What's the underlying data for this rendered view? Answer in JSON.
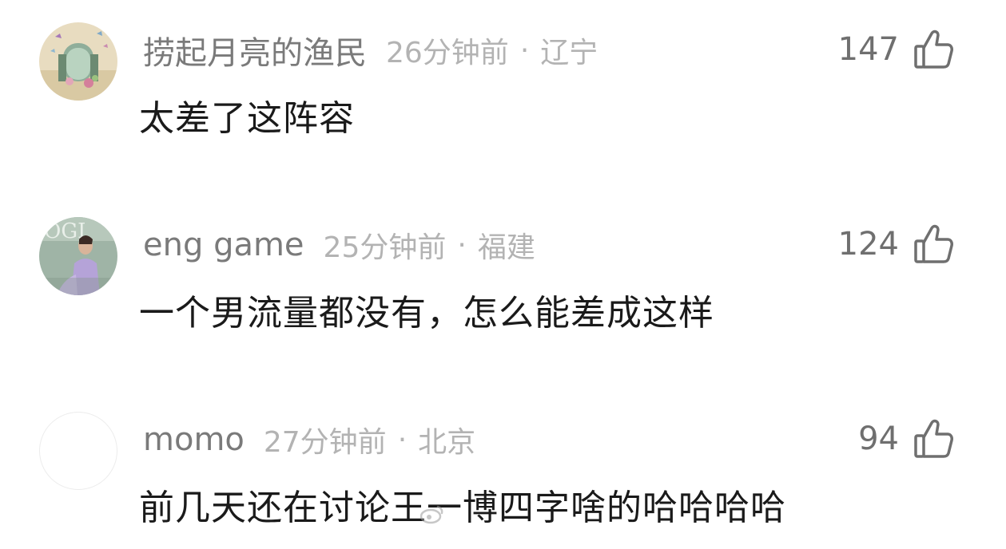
{
  "comments": [
    {
      "username": "捞起月亮的渔民",
      "time": "26分钟前",
      "separator": "·",
      "location": "辽宁",
      "likes": "147",
      "text": "太差了这阵容",
      "avatar": "butterfly-window-avatar"
    },
    {
      "username": "eng game",
      "time": "25分钟前",
      "separator": "·",
      "location": "福建",
      "likes": "124",
      "text": "一个男流量都没有，怎么能差成这样",
      "avatar": "vogue-cover-avatar"
    },
    {
      "username": "momo",
      "time": "27分钟前",
      "separator": "·",
      "location": "北京",
      "likes": "94",
      "text": "前几天还在讨论王一博四字啥的哈哈哈哈",
      "avatar": "blank-avatar"
    }
  ],
  "watermark": {
    "icon": "weibo-icon",
    "text": ""
  },
  "colors": {
    "username": "#7a7a7a",
    "meta": "#b3b3b3",
    "body_text": "#1a1a1a",
    "like": "#6f6f6f"
  }
}
